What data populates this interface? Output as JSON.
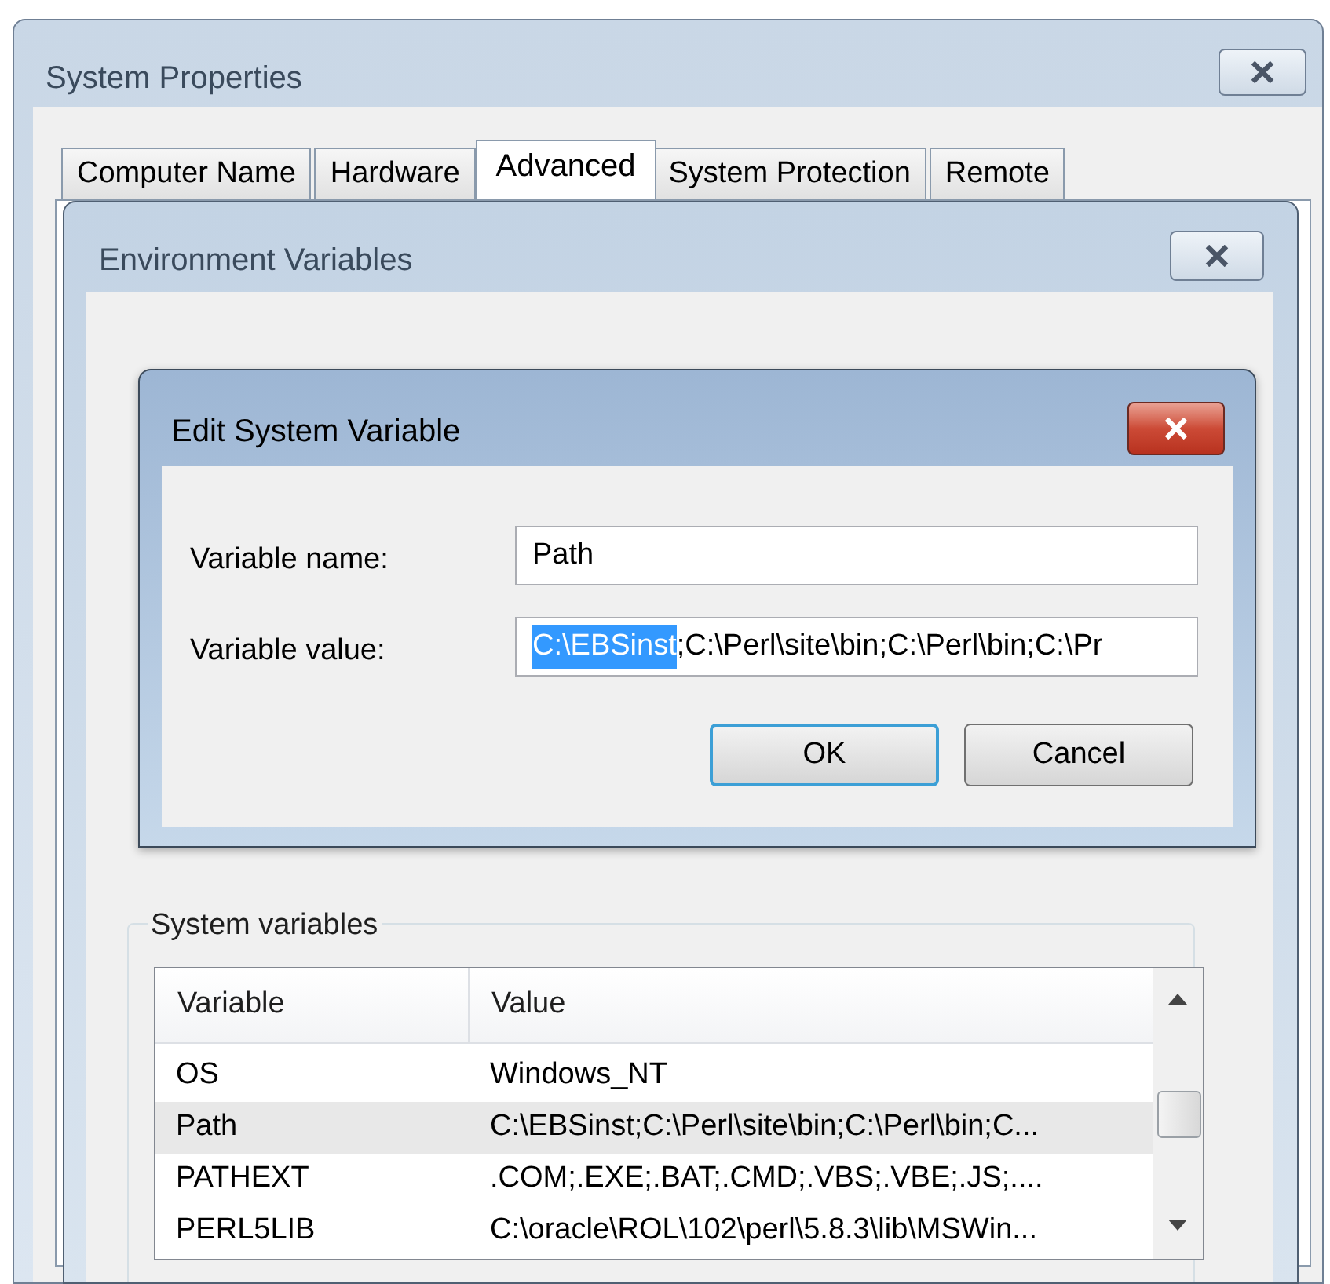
{
  "window": {
    "title": "System Properties"
  },
  "tabs": [
    {
      "label": "Computer Name",
      "selected": false
    },
    {
      "label": "Hardware",
      "selected": false
    },
    {
      "label": "Advanced",
      "selected": true
    },
    {
      "label": "System Protection",
      "selected": false
    },
    {
      "label": "Remote",
      "selected": false
    }
  ],
  "environment_dialog": {
    "title": "Environment Variables"
  },
  "edit_dialog": {
    "title": "Edit System Variable",
    "fields": [
      {
        "label": "Variable name:",
        "value": "Path"
      },
      {
        "label": "Variable value:",
        "selected_text": "C:\\EBSinst",
        "value": ";C:\\Perl\\site\\bin;C:\\Perl\\bin;C:\\Pr"
      }
    ],
    "buttons": [
      {
        "label": "OK",
        "default": true
      },
      {
        "label": "Cancel",
        "default": false
      }
    ]
  },
  "system_variables": {
    "title": "System variables",
    "columns": [
      "Variable",
      "Value"
    ],
    "rows": [
      {
        "cells": [
          "OS",
          "Windows_NT"
        ],
        "selected": false
      },
      {
        "cells": [
          "Path",
          "C:\\EBSinst;C:\\Perl\\site\\bin;C:\\Perl\\bin;C..."
        ],
        "selected": true
      },
      {
        "cells": [
          "PATHEXT",
          ".COM;.EXE;.BAT;.CMD;.VBS;.VBE;.JS;...."
        ],
        "selected": false
      },
      {
        "cells": [
          "PERL5LIB",
          "C:\\oracle\\ROL\\102\\perl\\5.8.3\\lib\\MSWin..."
        ],
        "selected": false
      }
    ]
  }
}
